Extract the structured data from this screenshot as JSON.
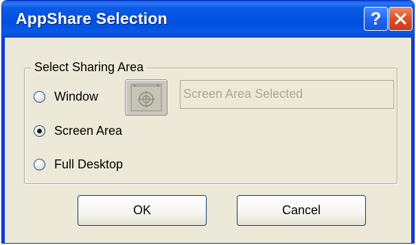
{
  "window": {
    "title": "AppShare Selection",
    "help_button_label": "?"
  },
  "group": {
    "label": "Select Sharing Area",
    "options": [
      {
        "label": "Window",
        "selected": false
      },
      {
        "label": "Screen Area",
        "selected": true
      },
      {
        "label": "Full Desktop",
        "selected": false
      }
    ],
    "area_field_text": "Screen Area Selected",
    "crosshair_icon": "crosshair-target-icon"
  },
  "buttons": {
    "ok": "OK",
    "cancel": "Cancel"
  },
  "colors": {
    "titlebar": "#0050e0",
    "close_button": "#e2522a",
    "dialog_background": "#ece9d8",
    "disabled_text": "#aca899"
  }
}
